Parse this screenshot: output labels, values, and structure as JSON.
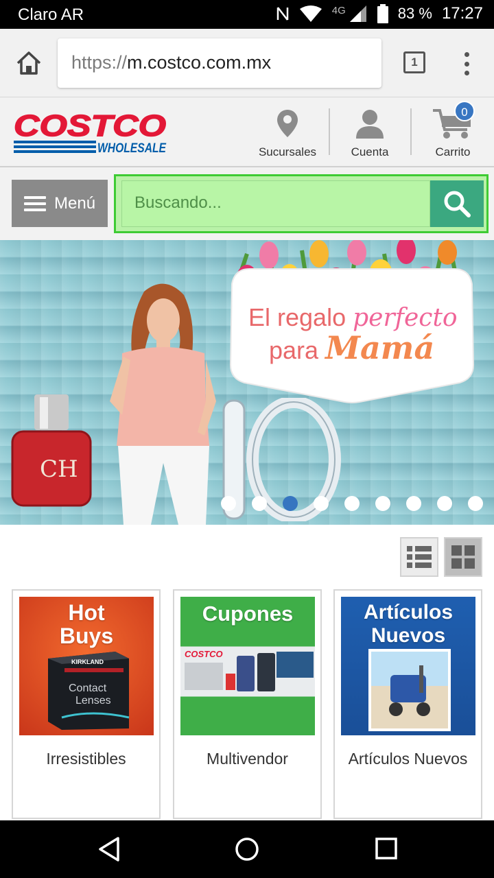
{
  "status_bar": {
    "carrier": "Claro AR",
    "network": "4G",
    "battery": "83 %",
    "time": "17:27"
  },
  "browser": {
    "url_scheme": "https://",
    "url_host": "m.costco.com.mx",
    "tab_count": "1"
  },
  "header": {
    "logo_top": "COSTCO",
    "logo_bottom": "WHOLESALE",
    "stores_label": "Sucursales",
    "account_label": "Cuenta",
    "cart_label": "Carrito",
    "cart_count": "0"
  },
  "search": {
    "menu_label": "Menú",
    "placeholder": "Buscando..."
  },
  "banner": {
    "line1_plain": "El regalo ",
    "line1_accent": "perfecto",
    "line2_plain": "para ",
    "line2_accent": "Mamá",
    "perfume_mark": "CH",
    "slide_count": 9,
    "active_slide": 3
  },
  "categories": [
    {
      "heading_line1": "Hot",
      "heading_line2": "Buys",
      "product_line1": "Contact",
      "product_line2": "Lenses",
      "brand": "KIRKLAND",
      "title": "Irresistibles"
    },
    {
      "heading_line1": "Cupones",
      "heading_line2": "",
      "brand": "COSTCO",
      "title": "Multivendor"
    },
    {
      "heading_line1": "Artículos",
      "heading_line2": "Nuevos",
      "title": "Artículos Nuevos"
    }
  ],
  "colors": {
    "logo_red": "#e31837",
    "logo_blue": "#005daa",
    "search_highlight": "#3ecb34",
    "search_bg": "#b9f2a8",
    "search_button": "#3ba880",
    "badge_blue": "#3876c2"
  }
}
